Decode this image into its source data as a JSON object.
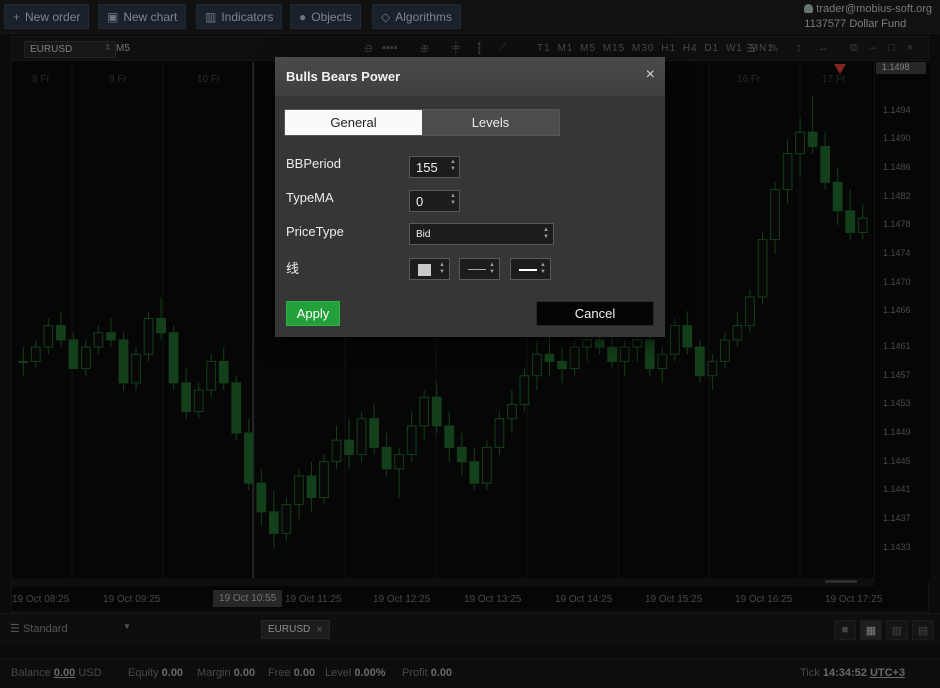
{
  "toolbar": {
    "new_order": "New order",
    "new_chart": "New chart",
    "indicators": "Indicators",
    "objects": "Objects",
    "algorithms": "Algorithms"
  },
  "account": {
    "user": "trader@mobius-soft.org",
    "id": "1137577",
    "fund": "Dollar Fund"
  },
  "chart": {
    "symbol": "EURUSD",
    "timeframe": "M5",
    "timeframes": "T1 M1 M5 M15 M30 H1 H4 D1 W1 MN1",
    "current_price": "1.1498",
    "x_cursor": "19 Oct 10:55",
    "top_labels": [
      "8 Fr",
      "9 Fr",
      "10 Fr",
      "16 Fr",
      "17 Fr"
    ]
  },
  "chart_data": {
    "type": "candlestick",
    "title": "",
    "y_ticks": [
      "1.1494",
      "1.1490",
      "1.1486",
      "1.1482",
      "1.1478",
      "1.1474",
      "1.1470",
      "1.1466",
      "1.1461",
      "1.1457",
      "1.1453",
      "1.1449",
      "1.1445",
      "1.1441",
      "1.1437",
      "1.1433"
    ],
    "x_ticks": [
      "19 Oct 08:25",
      "19 Oct 09:25",
      "19 Oct 11:25",
      "19 Oct 12:25",
      "19 Oct 13:25",
      "19 Oct 14:25",
      "19 Oct 15:25",
      "19 Oct 16:25",
      "19 Oct 17:25"
    ],
    "ylim": [
      1.1431,
      1.1498
    ],
    "candles": [
      [
        1.1459,
        1.1461,
        1.1457,
        1.1459
      ],
      [
        1.1459,
        1.1462,
        1.1458,
        1.1461
      ],
      [
        1.1461,
        1.1465,
        1.146,
        1.1464
      ],
      [
        1.1464,
        1.1466,
        1.1461,
        1.1462
      ],
      [
        1.1462,
        1.1463,
        1.1458,
        1.1458
      ],
      [
        1.1458,
        1.1462,
        1.1457,
        1.1461
      ],
      [
        1.1461,
        1.1464,
        1.146,
        1.1463
      ],
      [
        1.1463,
        1.1465,
        1.1461,
        1.1462
      ],
      [
        1.1462,
        1.1463,
        1.1455,
        1.1456
      ],
      [
        1.1456,
        1.1461,
        1.1455,
        1.146
      ],
      [
        1.146,
        1.1466,
        1.1459,
        1.1465
      ],
      [
        1.1465,
        1.1468,
        1.1462,
        1.1463
      ],
      [
        1.1463,
        1.1464,
        1.1455,
        1.1456
      ],
      [
        1.1456,
        1.1458,
        1.1451,
        1.1452
      ],
      [
        1.1452,
        1.1456,
        1.1451,
        1.1455
      ],
      [
        1.1455,
        1.146,
        1.1454,
        1.1459
      ],
      [
        1.1459,
        1.1461,
        1.1455,
        1.1456
      ],
      [
        1.1456,
        1.1457,
        1.1448,
        1.1449
      ],
      [
        1.1449,
        1.1451,
        1.1441,
        1.1442
      ],
      [
        1.1442,
        1.1444,
        1.1436,
        1.1438
      ],
      [
        1.1438,
        1.1441,
        1.1433,
        1.1435
      ],
      [
        1.1435,
        1.144,
        1.1434,
        1.1439
      ],
      [
        1.1439,
        1.1444,
        1.1437,
        1.1443
      ],
      [
        1.1443,
        1.1445,
        1.1438,
        1.144
      ],
      [
        1.144,
        1.1446,
        1.1439,
        1.1445
      ],
      [
        1.1445,
        1.145,
        1.1444,
        1.1448
      ],
      [
        1.1448,
        1.1451,
        1.1444,
        1.1446
      ],
      [
        1.1446,
        1.1452,
        1.1445,
        1.1451
      ],
      [
        1.1451,
        1.1453,
        1.1446,
        1.1447
      ],
      [
        1.1447,
        1.1449,
        1.1443,
        1.1444
      ],
      [
        1.1444,
        1.1447,
        1.144,
        1.1446
      ],
      [
        1.1446,
        1.1452,
        1.1445,
        1.145
      ],
      [
        1.145,
        1.1455,
        1.1448,
        1.1454
      ],
      [
        1.1454,
        1.1456,
        1.1449,
        1.145
      ],
      [
        1.145,
        1.1452,
        1.1445,
        1.1447
      ],
      [
        1.1447,
        1.1449,
        1.1443,
        1.1445
      ],
      [
        1.1445,
        1.1447,
        1.1441,
        1.1442
      ],
      [
        1.1442,
        1.1448,
        1.1441,
        1.1447
      ],
      [
        1.1447,
        1.1452,
        1.1446,
        1.1451
      ],
      [
        1.1451,
        1.1455,
        1.1449,
        1.1453
      ],
      [
        1.1453,
        1.1458,
        1.1452,
        1.1457
      ],
      [
        1.1457,
        1.1462,
        1.1455,
        1.146
      ],
      [
        1.146,
        1.1463,
        1.1457,
        1.1459
      ],
      [
        1.1459,
        1.1461,
        1.1456,
        1.1458
      ],
      [
        1.1458,
        1.1462,
        1.1457,
        1.1461
      ],
      [
        1.1461,
        1.1463,
        1.1459,
        1.1462
      ],
      [
        1.1462,
        1.1464,
        1.146,
        1.1461
      ],
      [
        1.1461,
        1.1463,
        1.1458,
        1.1459
      ],
      [
        1.1459,
        1.1462,
        1.1457,
        1.1461
      ],
      [
        1.1461,
        1.1464,
        1.1459,
        1.1462
      ],
      [
        1.1462,
        1.1463,
        1.1457,
        1.1458
      ],
      [
        1.1458,
        1.1461,
        1.1456,
        1.146
      ],
      [
        1.146,
        1.1465,
        1.1459,
        1.1464
      ],
      [
        1.1464,
        1.1466,
        1.146,
        1.1461
      ],
      [
        1.1461,
        1.1462,
        1.1456,
        1.1457
      ],
      [
        1.1457,
        1.146,
        1.1455,
        1.1459
      ],
      [
        1.1459,
        1.1463,
        1.1458,
        1.1462
      ],
      [
        1.1462,
        1.1466,
        1.1461,
        1.1464
      ],
      [
        1.1464,
        1.1469,
        1.1463,
        1.1468
      ],
      [
        1.1468,
        1.1477,
        1.1467,
        1.1476
      ],
      [
        1.1476,
        1.1484,
        1.1474,
        1.1483
      ],
      [
        1.1483,
        1.149,
        1.1481,
        1.1488
      ],
      [
        1.1488,
        1.1493,
        1.1485,
        1.1491
      ],
      [
        1.1491,
        1.1496,
        1.1488,
        1.1489
      ],
      [
        1.1489,
        1.1491,
        1.1483,
        1.1484
      ],
      [
        1.1484,
        1.1486,
        1.1478,
        1.148
      ],
      [
        1.148,
        1.1483,
        1.1476,
        1.1477
      ],
      [
        1.1477,
        1.1481,
        1.1476,
        1.1479
      ]
    ]
  },
  "dialog": {
    "title": "Bulls Bears Power",
    "close_glyph": "×",
    "tabs": [
      "General",
      "Levels"
    ],
    "fields": {
      "bb_period": {
        "label": "BBPeriod",
        "value": "155"
      },
      "type_ma": {
        "label": "TypeMA",
        "value": "0"
      },
      "price_type": {
        "label": "PriceType",
        "value": "Bid"
      },
      "line": {
        "label": "线"
      }
    },
    "apply": "Apply",
    "cancel": "Cancel"
  },
  "bottom": {
    "layout": "Standard",
    "chart_tab": "EURUSD",
    "tab_close": "×"
  },
  "status": {
    "balance_label": "Balance",
    "balance": "0.00",
    "currency": "USD",
    "equity_label": "Equity",
    "equity": "0.00",
    "margin_label": "Margin",
    "margin": "0.00",
    "free_label": "Free",
    "free": "0.00",
    "level_label": "Level",
    "level": "0.00%",
    "profit_label": "Profit",
    "profit": "0.00",
    "tick_label": "Tick",
    "time": "14:34:52",
    "tz": "UTC+3"
  },
  "colors": {
    "candle": "#1d5e27",
    "apply": "#24a03b",
    "marker": "#c0392b"
  }
}
